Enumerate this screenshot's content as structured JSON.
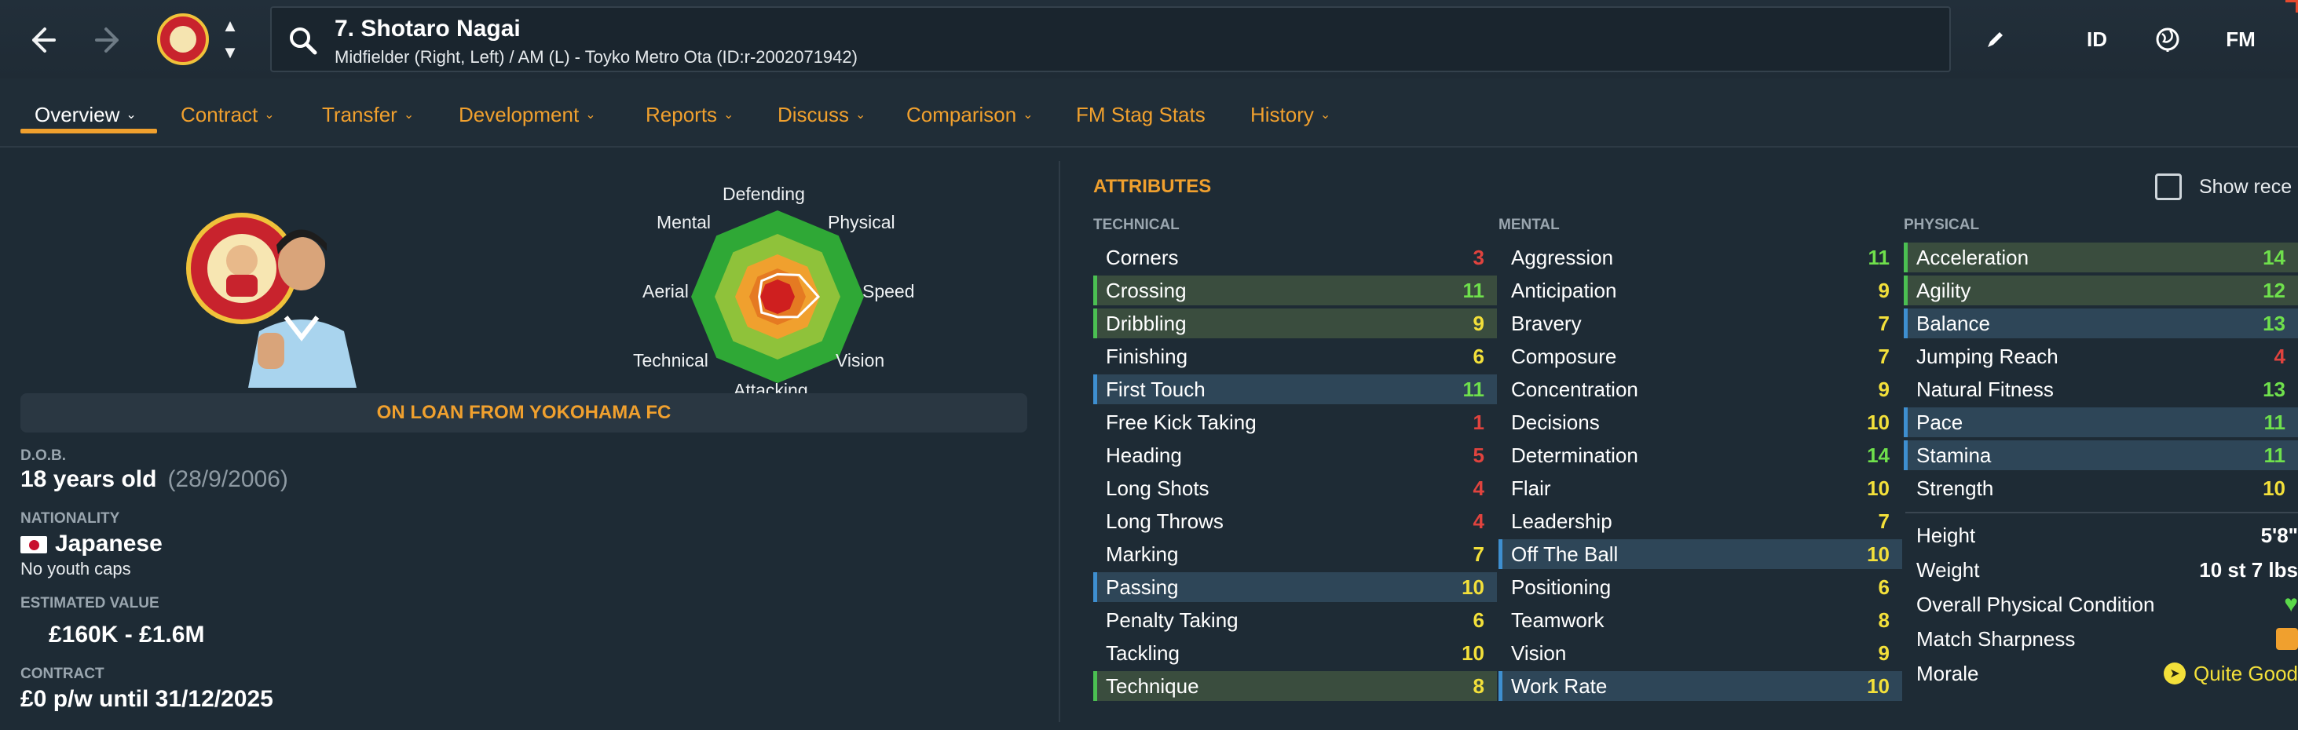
{
  "header": {
    "back_icon": "arrow-left-icon",
    "forward_icon": "arrow-right-icon",
    "player_title": "7. Shotaro Nagai",
    "player_subtitle": "Midfielder (Right, Left) / AM (L) - Toyko Metro Ota (ID:r-2002071942)",
    "actions": [
      "edit-icon",
      "ID",
      "globe-icon",
      "FM"
    ],
    "id_label": "ID",
    "fm_label": "FM"
  },
  "tabs": [
    {
      "label": "Overview",
      "active": true,
      "has_menu": true
    },
    {
      "label": "Contract",
      "has_menu": true
    },
    {
      "label": "Transfer",
      "has_menu": true
    },
    {
      "label": "Development",
      "has_menu": true
    },
    {
      "label": "Reports",
      "has_menu": true
    },
    {
      "label": "Discuss",
      "has_menu": true
    },
    {
      "label": "Comparison",
      "has_menu": true
    },
    {
      "label": "FM Stag Stats",
      "has_menu": false
    },
    {
      "label": "History",
      "has_menu": true
    }
  ],
  "radar": {
    "labels": {
      "defending": "Defending",
      "physical": "Physical",
      "speed": "Speed",
      "vision": "Vision",
      "attacking": "Attacking",
      "technical": "Technical",
      "aerial": "Aerial",
      "mental": "Mental"
    },
    "colors": {
      "outer": "#2fa836",
      "mid": "#8fc23a",
      "inner": "#f0a02e",
      "core": "#cf1f1f"
    }
  },
  "profile": {
    "on_loan": "ON LOAN FROM YOKOHAMA FC",
    "dob_label": "D.O.B.",
    "age": "18 years old",
    "dob": "(28/9/2006)",
    "nationality_label": "NATIONALITY",
    "nationality": "Japanese",
    "youth_caps": "No youth caps",
    "value_label": "ESTIMATED VALUE",
    "value": "£160K - £1.6M",
    "contract_label": "CONTRACT",
    "contract": "£0 p/w until 31/12/2025"
  },
  "attributes": {
    "title": "ATTRIBUTES",
    "show_recent": "Show rece",
    "technical_label": "TECHNICAL",
    "mental_label": "MENTAL",
    "physical_label": "PHYSICAL",
    "technical": [
      {
        "name": "Corners",
        "value": "3",
        "hl": ""
      },
      {
        "name": "Crossing",
        "value": "11",
        "hl": "green"
      },
      {
        "name": "Dribbling",
        "value": "9",
        "hl": "green"
      },
      {
        "name": "Finishing",
        "value": "6",
        "hl": ""
      },
      {
        "name": "First Touch",
        "value": "11",
        "hl": "blue"
      },
      {
        "name": "Free Kick Taking",
        "value": "1",
        "hl": ""
      },
      {
        "name": "Heading",
        "value": "5",
        "hl": ""
      },
      {
        "name": "Long Shots",
        "value": "4",
        "hl": ""
      },
      {
        "name": "Long Throws",
        "value": "4",
        "hl": ""
      },
      {
        "name": "Marking",
        "value": "7",
        "hl": ""
      },
      {
        "name": "Passing",
        "value": "10",
        "hl": "blue"
      },
      {
        "name": "Penalty Taking",
        "value": "6",
        "hl": ""
      },
      {
        "name": "Tackling",
        "value": "10",
        "hl": ""
      },
      {
        "name": "Technique",
        "value": "8",
        "hl": "green"
      }
    ],
    "mental": [
      {
        "name": "Aggression",
        "value": "11",
        "hl": ""
      },
      {
        "name": "Anticipation",
        "value": "9",
        "hl": ""
      },
      {
        "name": "Bravery",
        "value": "7",
        "hl": ""
      },
      {
        "name": "Composure",
        "value": "7",
        "hl": ""
      },
      {
        "name": "Concentration",
        "value": "9",
        "hl": ""
      },
      {
        "name": "Decisions",
        "value": "10",
        "hl": ""
      },
      {
        "name": "Determination",
        "value": "14",
        "hl": ""
      },
      {
        "name": "Flair",
        "value": "10",
        "hl": ""
      },
      {
        "name": "Leadership",
        "value": "7",
        "hl": ""
      },
      {
        "name": "Off The Ball",
        "value": "10",
        "hl": "blue"
      },
      {
        "name": "Positioning",
        "value": "6",
        "hl": ""
      },
      {
        "name": "Teamwork",
        "value": "8",
        "hl": ""
      },
      {
        "name": "Vision",
        "value": "9",
        "hl": ""
      },
      {
        "name": "Work Rate",
        "value": "10",
        "hl": "blue"
      }
    ],
    "physical": [
      {
        "name": "Acceleration",
        "value": "14",
        "hl": "green"
      },
      {
        "name": "Agility",
        "value": "12",
        "hl": "green"
      },
      {
        "name": "Balance",
        "value": "13",
        "hl": "blue"
      },
      {
        "name": "Jumping Reach",
        "value": "4",
        "hl": ""
      },
      {
        "name": "Natural Fitness",
        "value": "13",
        "hl": ""
      },
      {
        "name": "Pace",
        "value": "11",
        "hl": "blue"
      },
      {
        "name": "Stamina",
        "value": "11",
        "hl": "blue"
      },
      {
        "name": "Strength",
        "value": "10",
        "hl": ""
      }
    ],
    "info": {
      "height_label": "Height",
      "height": "5'8\"",
      "weight_label": "Weight",
      "weight": "10 st 7 lbs",
      "condition_label": "Overall Physical Condition",
      "sharpness_label": "Match Sharpness",
      "morale_label": "Morale",
      "morale": "Quite Good"
    }
  }
}
